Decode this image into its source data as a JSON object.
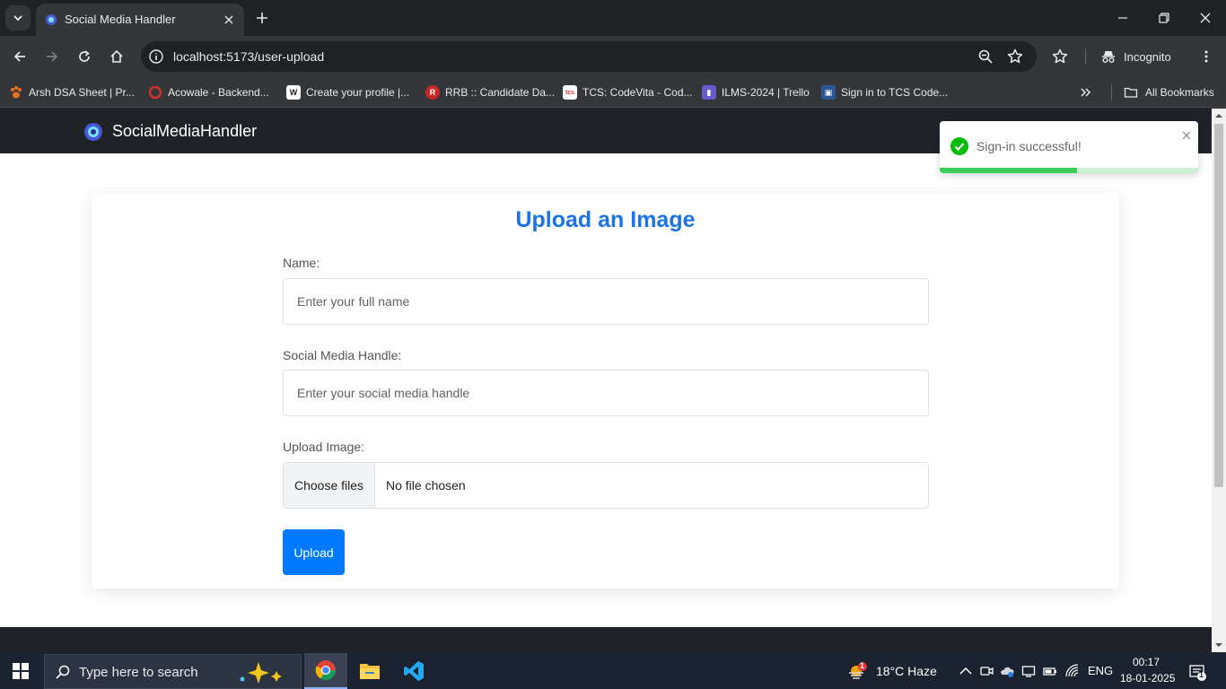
{
  "browser": {
    "tab_title": "Social Media Handler",
    "url": "localhost:5173/user-upload",
    "incognito_label": "Incognito",
    "bookmarks": [
      {
        "label": "Arsh DSA Sheet | Pr...",
        "icon": "paw-icon",
        "color": "#e8711c"
      },
      {
        "label": "Acowale - Backend...",
        "icon": "acowale-icon",
        "color": "#d93025"
      },
      {
        "label": "Create your profile |...",
        "icon": "w-icon",
        "color": "#ffffff"
      },
      {
        "label": "RRB :: Candidate Da...",
        "icon": "rrb-icon",
        "color": "#c62828"
      },
      {
        "label": "TCS: CodeVita - Cod...",
        "icon": "tcs-icon",
        "color": "#e53935"
      },
      {
        "label": "ILMS-2024 | Trello",
        "icon": "trello-icon",
        "color": "#6a5acd"
      },
      {
        "label": "Sign in to TCS Code...",
        "icon": "tcs-signin-icon",
        "color": "#8ab4f8"
      }
    ],
    "all_bookmarks_label": "All Bookmarks"
  },
  "app": {
    "brand": "SocialMediaHandler",
    "form": {
      "title": "Upload an Image",
      "name_label": "Name:",
      "name_placeholder": "Enter your full name",
      "handle_label": "Social Media Handle:",
      "handle_placeholder": "Enter your social media handle",
      "image_label": "Upload Image:",
      "choose_files_label": "Choose files",
      "file_status": "No file chosen",
      "upload_label": "Upload"
    },
    "toast": {
      "message": "Sign-in successful!",
      "progress_fraction": 0.53
    }
  },
  "taskbar": {
    "search_placeholder": "Type here to search",
    "weather": "18°C  Haze",
    "weather_badge": "1",
    "language": "ENG",
    "time": "00:17",
    "date": "18-01-2025",
    "notification_count": "1"
  },
  "colors": {
    "accent_blue": "#1a73e8",
    "button_blue": "#007bff",
    "navbar_dark": "#1f2328",
    "toast_green": "#3bcf5a"
  }
}
